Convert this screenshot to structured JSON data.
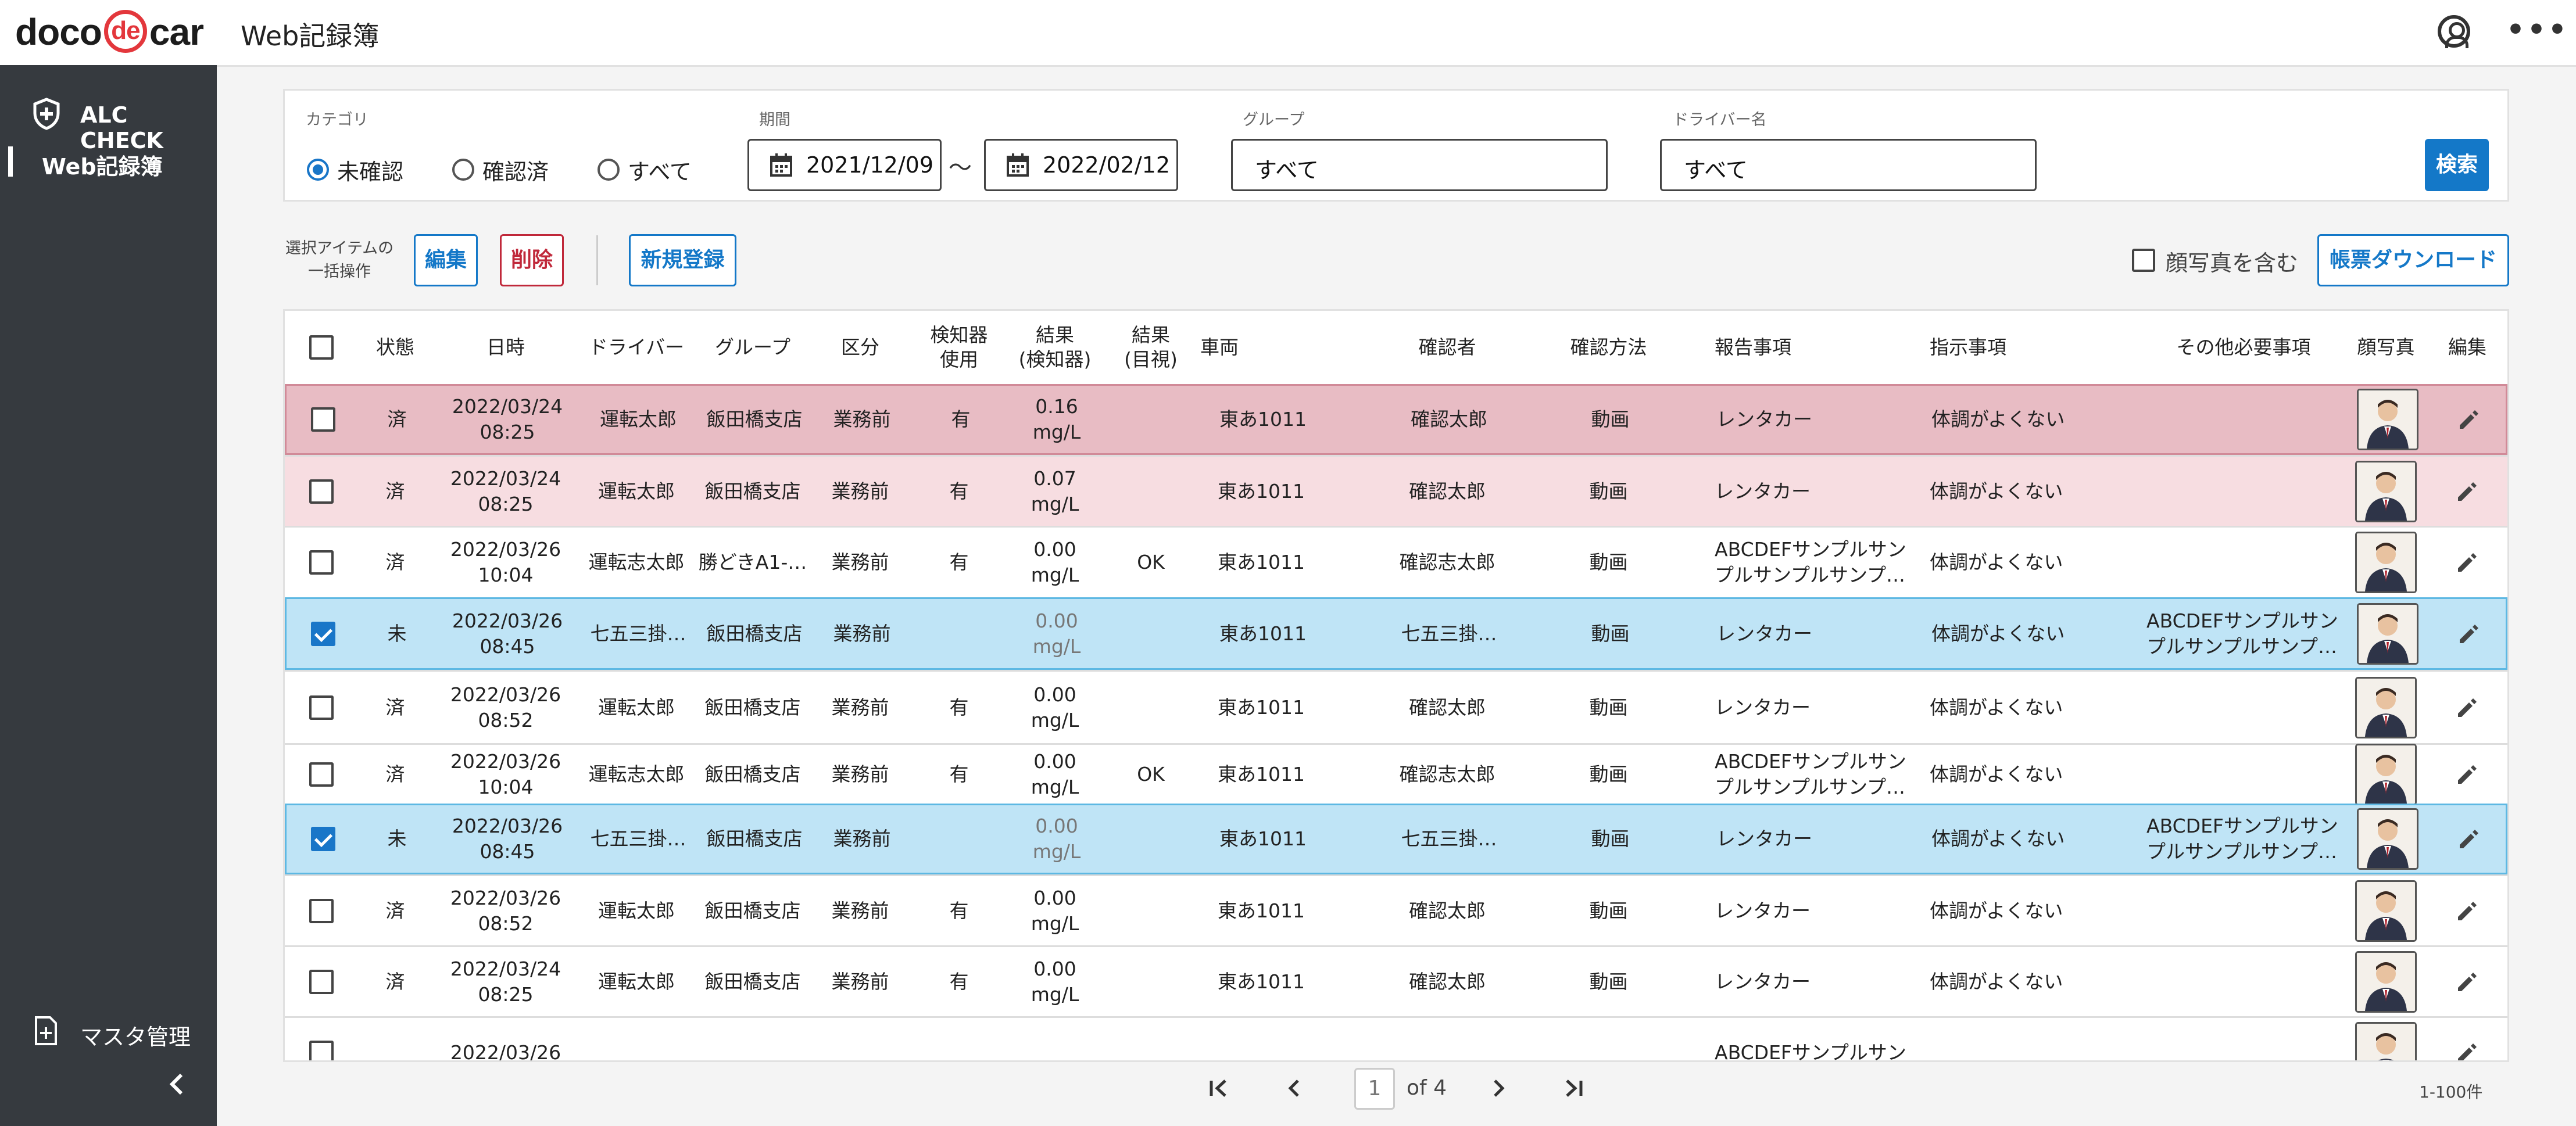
{
  "header": {
    "logo_left": "doco",
    "logo_mid": "de",
    "logo_right": "car",
    "title": "Web記録簿"
  },
  "sidebar": {
    "alc_check": "ALC CHECK",
    "web_record": "Web記録簿",
    "master": "マスタ管理"
  },
  "filters": {
    "category_label": "カテゴリ",
    "category_options": [
      "未確認",
      "確認済",
      "すべて"
    ],
    "category_selected": "未確認",
    "period_label": "期間",
    "date_from": "2021/12/09",
    "tilde": "〜",
    "date_to": "2022/02/12",
    "group_label": "グループ",
    "group_value": "すべて",
    "driver_label": "ドライバー名",
    "driver_value": "すべて",
    "search_button": "検索"
  },
  "actions": {
    "bulk_label_1": "選択アイテムの",
    "bulk_label_2": "一括操作",
    "edit": "編集",
    "delete": "削除",
    "new": "新規登録",
    "include_photo": "顔写真を含む",
    "download": "帳票ダウンロード"
  },
  "table": {
    "headers": [
      "状態",
      "日時",
      "ドライバー",
      "グループ",
      "区分",
      "検知器\n使用",
      "結果\n(検知器)",
      "結果\n(目視)",
      "車両",
      "確認者",
      "確認方法",
      "報告事項",
      "指示事項",
      "その他必要事項",
      "顔写真",
      "編集"
    ],
    "rows": [
      {
        "style": "red1",
        "checked": false,
        "status": "済",
        "date": "2022/03/24",
        "time": "08:25",
        "driver": "運転太郎",
        "group": "飯田橋支店",
        "kubun": "業務前",
        "detector": "有",
        "result_val": "0.16",
        "result_unit": "mg/L",
        "visual": "",
        "vehicle": "東あ1011",
        "checker": "確認太郎",
        "method": "動画",
        "report": "レンタカー",
        "instruction": "体調がよくない",
        "other": ""
      },
      {
        "style": "red2",
        "checked": false,
        "status": "済",
        "date": "2022/03/24",
        "time": "08:25",
        "driver": "運転太郎",
        "group": "飯田橋支店",
        "kubun": "業務前",
        "detector": "有",
        "result_val": "0.07",
        "result_unit": "mg/L",
        "visual": "",
        "vehicle": "東あ1011",
        "checker": "確認太郎",
        "method": "動画",
        "report": "レンタカー",
        "instruction": "体調がよくない",
        "other": ""
      },
      {
        "style": "",
        "checked": false,
        "status": "済",
        "date": "2022/03/26",
        "time": "10:04",
        "driver": "運転志太郎",
        "group": "勝どきA1-…",
        "kubun": "業務前",
        "detector": "有",
        "result_val": "0.00",
        "result_unit": "mg/L",
        "visual": "OK",
        "vehicle": "東あ1011",
        "checker": "確認志太郎",
        "method": "動画",
        "report": "ABCDEFサンプルサン\nプルサンプルサンプ…",
        "instruction": "体調がよくない",
        "other": ""
      },
      {
        "style": "blue",
        "checked": true,
        "status": "未",
        "date": "2022/03/26",
        "time": "08:45",
        "driver": "七五三掛…",
        "group": "飯田橋支店",
        "kubun": "業務前",
        "detector": "",
        "result_val": "0.00",
        "result_unit": "mg/L",
        "visual": "",
        "vehicle": "東あ1011",
        "checker": "七五三掛…",
        "method": "動画",
        "report": "レンタカー",
        "instruction": "体調がよくない",
        "other": "ABCDEFサンプルサン\nプルサンプルサンプ…"
      },
      {
        "style": "",
        "checked": false,
        "status": "済",
        "date": "2022/03/26",
        "time": "08:52",
        "driver": "運転太郎",
        "group": "飯田橋支店",
        "kubun": "業務前",
        "detector": "有",
        "result_val": "0.00",
        "result_unit": "mg/L",
        "visual": "",
        "vehicle": "東あ1011",
        "checker": "確認太郎",
        "method": "動画",
        "report": "レンタカー",
        "instruction": "体調がよくない",
        "other": ""
      },
      {
        "style": "",
        "checked": false,
        "status": "済",
        "date": "2022/03/26",
        "time": "10:04",
        "driver": "運転志太郎",
        "group": "飯田橋支店",
        "kubun": "業務前",
        "detector": "有",
        "result_val": "0.00",
        "result_unit": "mg/L",
        "visual": "OK",
        "vehicle": "東あ1011",
        "checker": "確認志太郎",
        "method": "動画",
        "report": "ABCDEFサンプルサン\nプルサンプルサンプ…",
        "instruction": "体調がよくない",
        "other": ""
      },
      {
        "style": "blue",
        "checked": true,
        "status": "未",
        "date": "2022/03/26",
        "time": "08:45",
        "driver": "七五三掛…",
        "group": "飯田橋支店",
        "kubun": "業務前",
        "detector": "",
        "result_val": "0.00",
        "result_unit": "mg/L",
        "visual": "",
        "vehicle": "東あ1011",
        "checker": "七五三掛…",
        "method": "動画",
        "report": "レンタカー",
        "instruction": "体調がよくない",
        "other": "ABCDEFサンプルサン\nプルサンプルサンプ…"
      },
      {
        "style": "",
        "checked": false,
        "status": "済",
        "date": "2022/03/26",
        "time": "08:52",
        "driver": "運転太郎",
        "group": "飯田橋支店",
        "kubun": "業務前",
        "detector": "有",
        "result_val": "0.00",
        "result_unit": "mg/L",
        "visual": "",
        "vehicle": "東あ1011",
        "checker": "確認太郎",
        "method": "動画",
        "report": "レンタカー",
        "instruction": "体調がよくない",
        "other": ""
      },
      {
        "style": "",
        "checked": false,
        "status": "済",
        "date": "2022/03/24",
        "time": "08:25",
        "driver": "運転太郎",
        "group": "飯田橋支店",
        "kubun": "業務前",
        "detector": "有",
        "result_val": "0.00",
        "result_unit": "mg/L",
        "visual": "",
        "vehicle": "東あ1011",
        "checker": "確認太郎",
        "method": "動画",
        "report": "レンタカー",
        "instruction": "体調がよくない",
        "other": ""
      },
      {
        "style": "",
        "checked": false,
        "status": "",
        "date": "2022/03/26",
        "time": "",
        "driver": "",
        "group": "",
        "kubun": "",
        "detector": "",
        "result_val": "",
        "result_unit": "",
        "visual": "",
        "vehicle": "",
        "checker": "",
        "method": "",
        "report": "ABCDEFサンプルサン",
        "instruction": "",
        "other": ""
      }
    ]
  },
  "pager": {
    "page": "1",
    "of": "of 4",
    "count": "1-100件"
  },
  "colors": {
    "accent": "#1478c8",
    "danger": "#c0283a",
    "sidebar": "#363a3f",
    "row_red": "#e8bcc4",
    "row_pink": "#f7dde1",
    "row_blue": "#bfe4f6"
  }
}
